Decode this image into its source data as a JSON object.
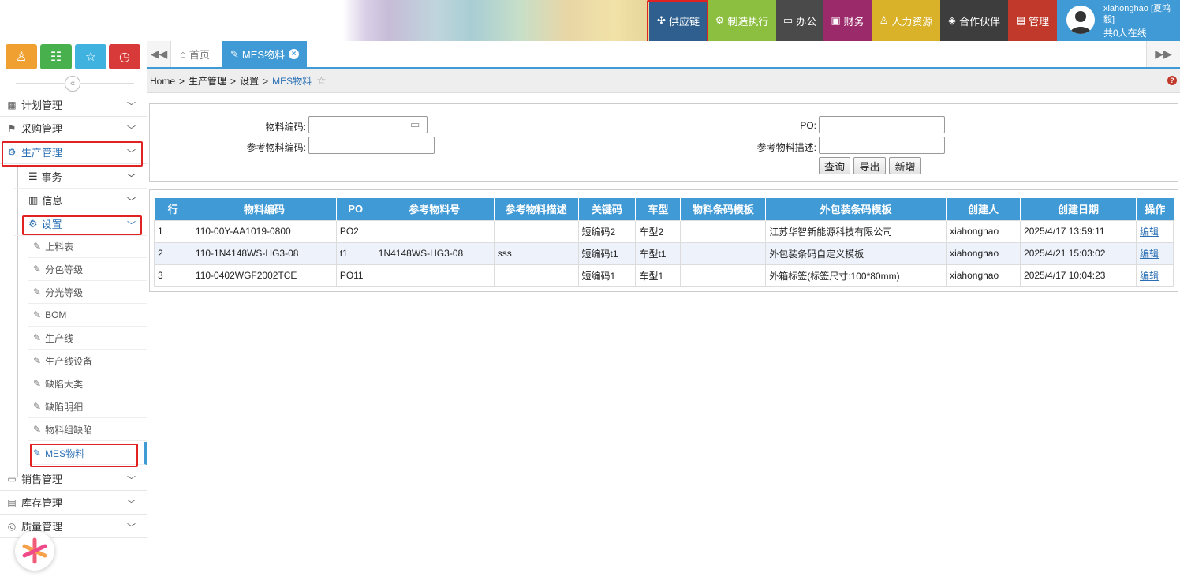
{
  "topnav": {
    "items": [
      {
        "label": "供应链",
        "icon": "network-icon",
        "color": "#2e5f8e"
      },
      {
        "label": "制造执行",
        "icon": "gear-icon",
        "color": "#8cbf3f"
      },
      {
        "label": "办公",
        "icon": "monitor-icon",
        "color": "#4a4a4a"
      },
      {
        "label": "财务",
        "icon": "wallet-icon",
        "color": "#9b2a6b"
      },
      {
        "label": "人力资源",
        "icon": "person-icon",
        "color": "#d9b22a"
      },
      {
        "label": "合作伙伴",
        "icon": "diamond-icon",
        "color": "#3d3d3d"
      },
      {
        "label": "管理",
        "icon": "doc-icon",
        "color": "#c0392b"
      }
    ]
  },
  "user": {
    "name": "xiahonghao [夏鸿毅]",
    "online": "共0人在线"
  },
  "sidebar": {
    "quick_buttons": [
      {
        "icon": "user-icon",
        "color": "#f0a030"
      },
      {
        "icon": "list-icon",
        "color": "#49b04e"
      },
      {
        "icon": "star-icon",
        "color": "#3fb2e0"
      },
      {
        "icon": "history-icon",
        "color": "#d83a3a"
      }
    ],
    "collapse_symbol": "«",
    "menu": [
      {
        "label": "计划管理"
      },
      {
        "label": "采购管理"
      },
      {
        "label": "生产管理"
      }
    ],
    "sub": [
      {
        "label": "事务"
      },
      {
        "label": "信息"
      },
      {
        "label": "设置"
      }
    ],
    "leaves": [
      "上料表",
      "分色等级",
      "分光等级",
      "BOM",
      "生产线",
      "生产线设备",
      "缺陷大类",
      "缺陷明细",
      "物料组缺陷",
      "MES物料"
    ],
    "menu_bottom": [
      {
        "label": "销售管理"
      },
      {
        "label": "库存管理"
      },
      {
        "label": "质量管理"
      }
    ]
  },
  "tabs": [
    {
      "label": "首页"
    },
    {
      "label": "MES物料"
    }
  ],
  "breadcrumb": {
    "home": "Home",
    "l1": "生产管理",
    "l2": "设置",
    "current": "MES物料",
    "sep": ">"
  },
  "filter": {
    "material_code_label": "物料编码:",
    "material_code_value": "",
    "ref_material_code_label": "参考物料编码:",
    "ref_material_code_value": "",
    "po_label": "PO:",
    "po_value": "",
    "ref_desc_label": "参考物料描述:",
    "ref_desc_value": "",
    "query_label": "查询",
    "export_label": "导出",
    "add_label": "新增"
  },
  "grid": {
    "headers": [
      "行",
      "物料编码",
      "PO",
      "参考物料号",
      "参考物料描述",
      "关键码",
      "车型",
      "物料条码模板",
      "外包装条码模板",
      "创建人",
      "创建日期",
      "操作"
    ],
    "rows": [
      [
        "1",
        "110-00Y-AA1019-0800",
        "PO2",
        "",
        "",
        "短编码2",
        "车型2",
        "",
        "江苏华智新能源科技有限公司",
        "xiahonghao",
        "2025/4/17 13:59:11",
        "编辑"
      ],
      [
        "2",
        "110-1N4148WS-HG3-08",
        "t1",
        "1N4148WS-HG3-08",
        "sss",
        "短编码t1",
        "车型t1",
        "",
        "外包装条码自定义模板",
        "xiahonghao",
        "2025/4/21 15:03:02",
        "编辑"
      ],
      [
        "3",
        "110-0402WGF2002TCE",
        "PO11",
        "",
        "",
        "短编码1",
        "车型1",
        "",
        "外箱标签(标签尺寸:100*80mm)",
        "xiahonghao",
        "2025/4/17 10:04:23",
        "编辑"
      ]
    ]
  }
}
